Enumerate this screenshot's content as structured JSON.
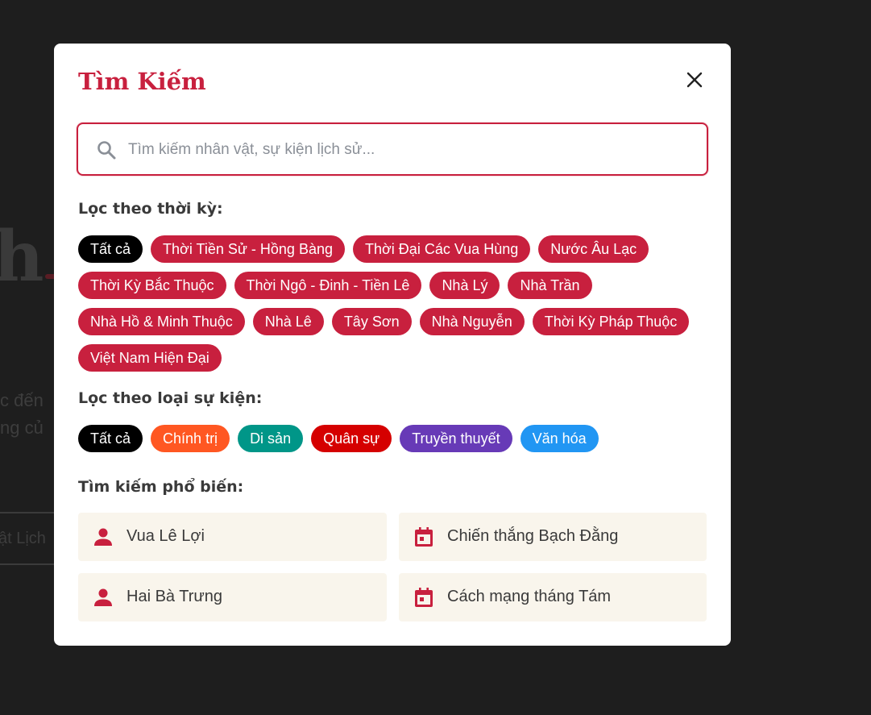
{
  "background": {
    "big_text": "h",
    "line1": "c đến",
    "line2": "ng củ",
    "button_text": "ật Lịch"
  },
  "modal": {
    "title": "Tìm Kiếm",
    "close_icon": "close-icon",
    "search": {
      "placeholder": "Tìm kiếm nhân vật, sự kiện lịch sử...",
      "value": ""
    }
  },
  "period_filter": {
    "label": "Lọc theo thời kỳ:",
    "chips": [
      {
        "label": "Tất cả",
        "color": "#000000",
        "active": true
      },
      {
        "label": "Thời Tiền Sử - Hồng Bàng",
        "color": "#c8203e"
      },
      {
        "label": "Thời Đại Các Vua Hùng",
        "color": "#c8203e"
      },
      {
        "label": "Nước Âu Lạc",
        "color": "#c8203e"
      },
      {
        "label": "Thời Kỳ Bắc Thuộc",
        "color": "#c8203e"
      },
      {
        "label": "Thời Ngô - Đinh - Tiền Lê",
        "color": "#c8203e"
      },
      {
        "label": "Nhà Lý",
        "color": "#c8203e"
      },
      {
        "label": "Nhà Trần",
        "color": "#c8203e"
      },
      {
        "label": "Nhà Hồ & Minh Thuộc",
        "color": "#c8203e"
      },
      {
        "label": "Nhà Lê",
        "color": "#c8203e"
      },
      {
        "label": "Tây Sơn",
        "color": "#c8203e"
      },
      {
        "label": "Nhà Nguyễn",
        "color": "#c8203e"
      },
      {
        "label": "Thời Kỳ Pháp Thuộc",
        "color": "#c8203e"
      },
      {
        "label": "Việt Nam Hiện Đại",
        "color": "#c8203e"
      }
    ]
  },
  "event_filter": {
    "label": "Lọc theo loại sự kiện:",
    "chips": [
      {
        "label": "Tất cả",
        "color": "#000000",
        "active": true
      },
      {
        "label": "Chính trị",
        "color": "#ff5722"
      },
      {
        "label": "Di sản",
        "color": "#009688"
      },
      {
        "label": "Quân sự",
        "color": "#d50000"
      },
      {
        "label": "Truyền thuyết",
        "color": "#673ab7"
      },
      {
        "label": "Văn hóa",
        "color": "#2196f3"
      }
    ]
  },
  "popular": {
    "label": "Tìm kiếm phổ biến:",
    "items": [
      {
        "label": "Vua Lê Lợi",
        "icon": "person-icon"
      },
      {
        "label": "Chiến thắng Bạch Đằng",
        "icon": "calendar-icon"
      },
      {
        "label": "Hai Bà Trưng",
        "icon": "person-icon"
      },
      {
        "label": "Cách mạng tháng Tám",
        "icon": "calendar-icon"
      }
    ]
  },
  "colors": {
    "accent": "#c8203e",
    "modal_bg": "#ffffff",
    "overlay": "#1e1e1e",
    "popular_bg": "#f9f5ec"
  }
}
